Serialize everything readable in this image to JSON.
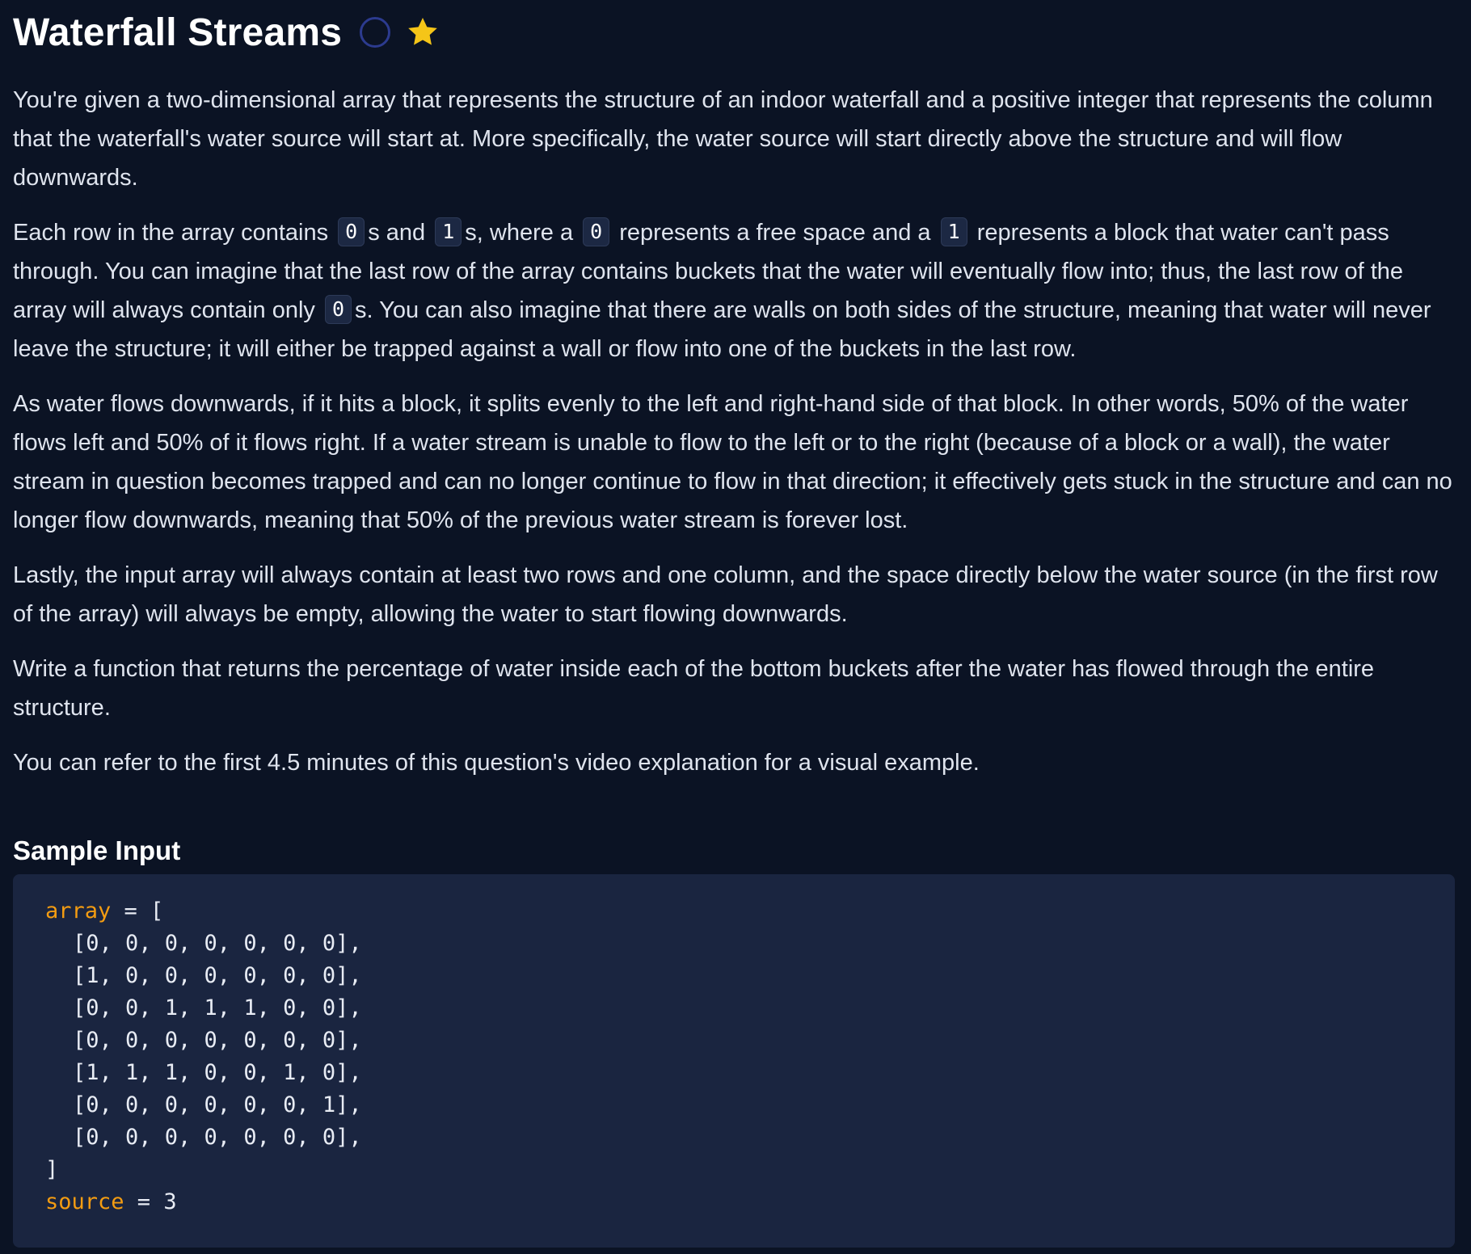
{
  "title": "Waterfall Streams",
  "icons": {
    "status": "empty-circle-icon",
    "favorite": "star-icon",
    "star_color": "#f5c518"
  },
  "description": {
    "p1": "You're given a two-dimensional array that represents the structure of an indoor waterfall and a positive integer that represents the column that the waterfall's water source will start at. More specifically, the water source will start directly above the structure and will flow downwards.",
    "p2": {
      "t1": "Each row in the array contains ",
      "c1": "0",
      "t2": "s and ",
      "c2": "1",
      "t3": "s, where a ",
      "c3": "0",
      "t4": " represents a free space and a ",
      "c4": "1",
      "t5": " represents a block that water can't pass through. You can imagine that the last row of the array contains buckets that the water will eventually flow into; thus, the last row of the array will always contain only ",
      "c5": "0",
      "t6": "s. You can also imagine that there are walls on both sides of the structure, meaning that water will never leave the structure; it will either be trapped against a wall or flow into one of the buckets in the last row."
    },
    "p3": "As water flows downwards, if it hits a block, it splits evenly to the left and right-hand side of that block. In other words, 50% of the water flows left and 50% of it flows right. If a water stream is unable to flow to the left or to the right (because of a block or a wall), the water stream in question becomes trapped and can no longer continue to flow in that direction; it effectively gets stuck in the structure and can no longer flow downwards, meaning that 50% of the previous water stream is forever lost.",
    "p4": "Lastly, the input array will always contain at least two rows and one column, and the space directly below the water source (in the first row of the array) will always be empty, allowing the water to start flowing downwards.",
    "p5": "Write a function that returns the percentage of water inside each of the bottom buckets after the water has flowed through the entire structure.",
    "p6": "You can refer to the first 4.5 minutes of this question's video explanation for a visual example."
  },
  "sample": {
    "heading": "Sample Input",
    "array_var": "array",
    "array_open": " = [",
    "rows": [
      "[0, 0, 0, 0, 0, 0, 0],",
      "[1, 0, 0, 0, 0, 0, 0],",
      "[0, 0, 1, 1, 1, 0, 0],",
      "[0, 0, 0, 0, 0, 0, 0],",
      "[1, 1, 1, 0, 0, 1, 0],",
      "[0, 0, 0, 0, 0, 0, 1],",
      "[0, 0, 0, 0, 0, 0, 0],"
    ],
    "array_close": "]",
    "source_var": "source",
    "source_val": " = 3"
  }
}
